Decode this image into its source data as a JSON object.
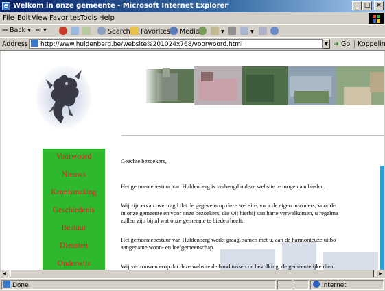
{
  "window": {
    "title": "Welkom in onze gemeente - Microsoft Internet Explorer",
    "min_label": "_",
    "max_label": "□",
    "close_label": "×"
  },
  "menu": [
    "File",
    "Edit",
    "View",
    "Favorites",
    "Tools",
    "Help"
  ],
  "toolbar": {
    "back": "Back",
    "search": "Search",
    "favorites": "Favorites",
    "media": "Media"
  },
  "address": {
    "label": "Address",
    "url": "http://www.huldenberg.be/website%201024x768/voorwoord.html",
    "go": "Go",
    "links": "Koppelingen"
  },
  "nav": {
    "items": [
      "Voorwoord",
      "Nieuws",
      "Kennismaking",
      "Geschiedenis",
      "Bestuur",
      "Diensten",
      "Onderwijs"
    ]
  },
  "body": {
    "greeting": "Geachte bezoekers,",
    "lines": [
      "Het gemeentebestuur van Huldenberg is verheugd u deze website te mogen aanbieden.",
      "Wij zijn ervan overtuigd dat de gegevens op deze website, voor de eigen inwoners, voor de",
      "in onze gemeente en voor onze bezoekers, die wij hierbij van harte verwelkomen, u regelma",
      "zullen zijn bij al wat onze gemeente te bieden heeft.",
      "Het gemeentebestuur van Huldenberg werkt graag, samen met u, aan de harmonieuze uitbo",
      "aangename woon- en leefgemeenschap.",
      "Wij vertrouwen erop dat deze website de band tussen de bevolking, de gemeentelijke dien"
    ]
  },
  "status": {
    "text": "Done",
    "zone": "Internet"
  },
  "colors": {
    "nav_bg": "#2db82d",
    "nav_text": "#e32020",
    "titlebar": "#0a246a"
  }
}
